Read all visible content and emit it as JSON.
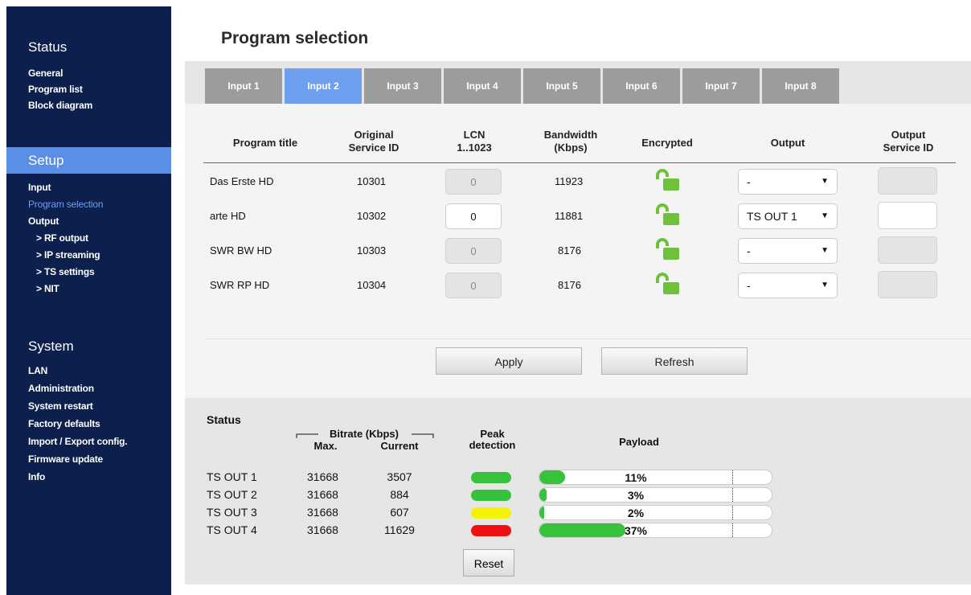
{
  "sidebar": {
    "status_head": "Status",
    "status_items": [
      "General",
      "Program list",
      "Block diagram"
    ],
    "setup_head": "Setup",
    "setup_items": [
      "Input",
      "Program selection",
      "Output",
      "> RF output",
      "> IP streaming",
      "> TS settings",
      "> NIT"
    ],
    "system_head": "System",
    "system_items": [
      "LAN",
      "Administration",
      "System restart",
      "Factory defaults",
      "Import / Export config.",
      "Firmware update",
      "Info"
    ]
  },
  "page": {
    "title": "Program selection"
  },
  "tabs": [
    "Input 1",
    "Input 2",
    "Input 3",
    "Input 4",
    "Input 5",
    "Input 6",
    "Input 7",
    "Input 8"
  ],
  "active_tab": "Input 2",
  "table": {
    "headers": {
      "program_title": "Program title",
      "original_sid_1": "Original",
      "original_sid_2": "Service ID",
      "lcn_1": "LCN",
      "lcn_2": "1..1023",
      "bandwidth_1": "Bandwidth",
      "bandwidth_2": "(Kbps)",
      "encrypted": "Encrypted",
      "output": "Output",
      "output_sid_1": "Output",
      "output_sid_2": "Service ID"
    },
    "rows": [
      {
        "title": "Das Erste HD",
        "sid": "10301",
        "lcn": "0",
        "bandwidth": "11923",
        "encrypted": "unlocked",
        "output": "-",
        "output_sid": ""
      },
      {
        "title": "arte HD",
        "sid": "10302",
        "lcn": "0",
        "bandwidth": "11881",
        "encrypted": "unlocked",
        "output": "TS OUT 1",
        "output_sid": ""
      },
      {
        "title": "SWR BW HD",
        "sid": "10303",
        "lcn": "0",
        "bandwidth": "8176",
        "encrypted": "unlocked",
        "output": "-",
        "output_sid": ""
      },
      {
        "title": "SWR RP HD",
        "sid": "10304",
        "lcn": "0",
        "bandwidth": "8176",
        "encrypted": "unlocked",
        "output": "-",
        "output_sid": ""
      }
    ]
  },
  "buttons": {
    "apply": "Apply",
    "refresh": "Refresh"
  },
  "status": {
    "title": "Status",
    "bitrate_header": "Bitrate (Kbps)",
    "max_header": "Max.",
    "current_header": "Current",
    "peak_header_1": "Peak",
    "peak_header_2": "detection",
    "payload_header": "Payload",
    "reset_label": "Reset",
    "rows": [
      {
        "name": "TS OUT 1",
        "max": "31668",
        "current": "3507",
        "peak": "green",
        "payload_pct": "11%",
        "payload": 0.11
      },
      {
        "name": "TS OUT 2",
        "max": "31668",
        "current": "884",
        "peak": "green",
        "payload_pct": "3%",
        "payload": 0.03
      },
      {
        "name": "TS OUT 3",
        "max": "31668",
        "current": "607",
        "peak": "yellow",
        "payload_pct": "2%",
        "payload": 0.02
      },
      {
        "name": "TS OUT 4",
        "max": "31668",
        "current": "11629",
        "peak": "red",
        "payload_pct": "37%",
        "payload": 0.37
      }
    ]
  },
  "colors": {
    "sidebar_bg": "#0d1f4c",
    "accent": "#5b8ee6",
    "tab_inactive": "#9c9c9c",
    "lock_green": "#6fc13b",
    "peak_green": "#36c23a",
    "peak_yellow": "#f5f20a",
    "peak_red": "#ee1111"
  },
  "icons": {
    "encrypted": "unlocked-padlock-icon",
    "dropdown": "caret-down-icon"
  }
}
